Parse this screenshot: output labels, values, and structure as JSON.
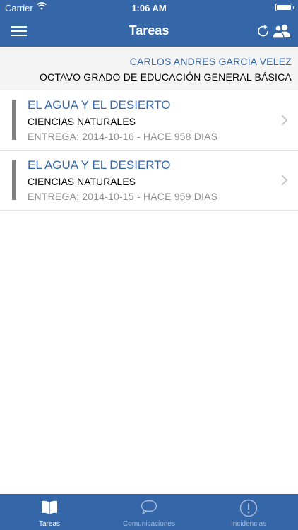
{
  "status_bar": {
    "carrier": "Carrier",
    "time": "1:06 AM"
  },
  "nav": {
    "title": "Tareas",
    "menu_icon": "menu-icon",
    "refresh_icon": "refresh-icon",
    "users_icon": "users-icon"
  },
  "student": {
    "name": "CARLOS ANDRES GARCÍA VELEZ",
    "grade": "OCTAVO GRADO DE EDUCACIÓN GENERAL BÁSICA"
  },
  "tasks": [
    {
      "title": "EL AGUA Y EL DESIERTO",
      "subject": "CIENCIAS NATURALES",
      "due": "ENTREGA: 2014-10-16 - HACE 958 DIAS"
    },
    {
      "title": "EL AGUA Y EL DESIERTO",
      "subject": "CIENCIAS NATURALES",
      "due": "ENTREGA: 2014-10-15 - HACE 959 DIAS"
    }
  ],
  "tabs": [
    {
      "label": "Tareas",
      "icon": "book-icon",
      "active": true
    },
    {
      "label": "Comunicaciones",
      "icon": "chat-bubble-icon",
      "active": false
    },
    {
      "label": "Incidencias",
      "icon": "alert-icon",
      "active": false
    }
  ],
  "colors": {
    "primary": "#3466a8",
    "accent_bar": "#808080",
    "muted_text": "#8e8e8e"
  }
}
